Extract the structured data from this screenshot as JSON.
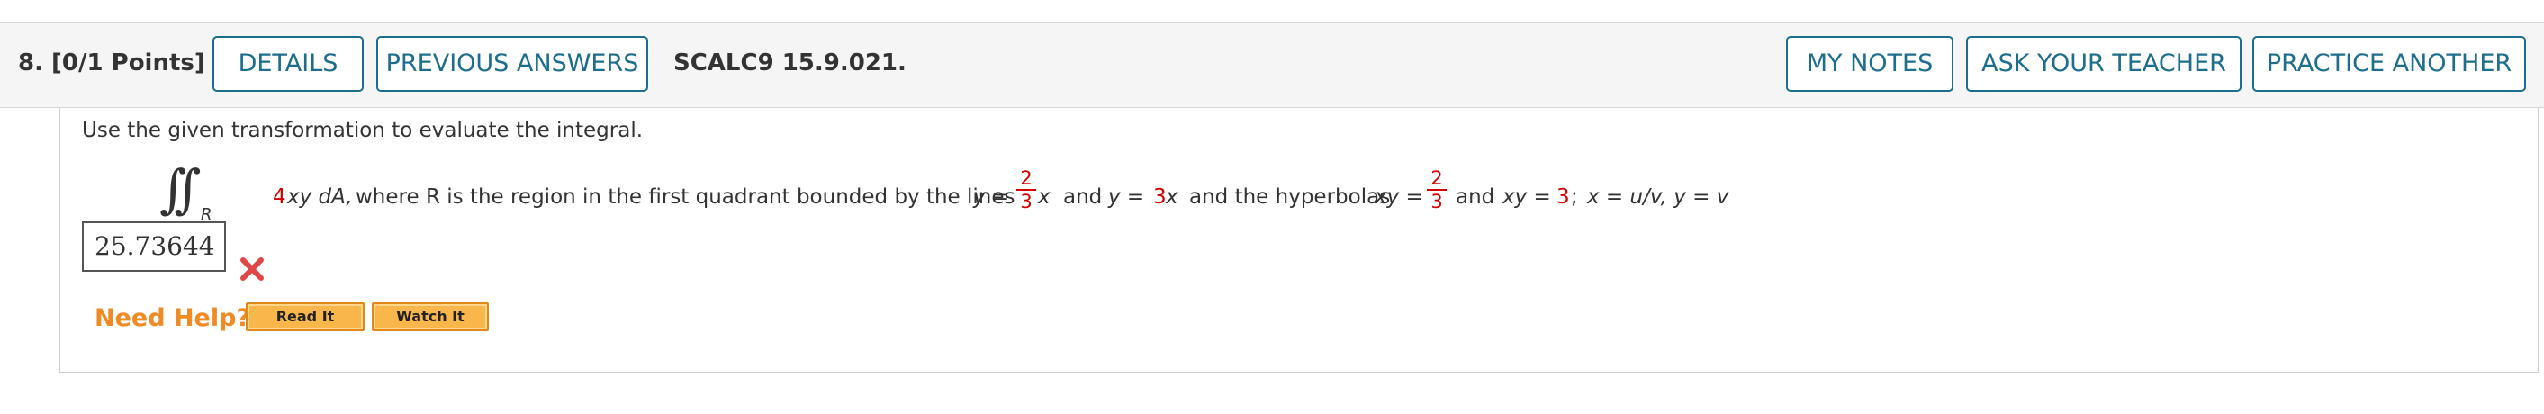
{
  "header": {
    "question_label": "8.  [0/1 Points]",
    "details_label": "DETAILS",
    "previous_answers_label": "PREVIOUS ANSWERS",
    "question_id": "SCALC9 15.9.021.",
    "my_notes_label": "MY NOTES",
    "ask_teacher_label": "ASK YOUR TEACHER",
    "practice_another_label": "PRACTICE ANOTHER"
  },
  "question": {
    "prompt": "Use the given transformation to evaluate the integral.",
    "integral_region": "R",
    "integrand_coef": "4",
    "integrand_rest": "xy dA,",
    "text_where": "where R is the region in the first quadrant bounded by the lines",
    "line1_lhs": "y =",
    "line1_frac_num": "2",
    "line1_frac_den": "3",
    "line1_var": "x",
    "and1": "and",
    "line2_lhs": "y =",
    "line2_coef": "3",
    "line2_var": "x",
    "text_hyperbolas": "and the hyperbolas",
    "hyp1_lhs": "xy =",
    "hyp1_frac_num": "2",
    "hyp1_frac_den": "3",
    "and2": "and",
    "hyp2_lhs": "xy =",
    "hyp2_val": "3",
    "semicolon": ";",
    "transformation": "x = u/v, y = v"
  },
  "answer": {
    "value": "25.73644",
    "status": "incorrect"
  },
  "help": {
    "need_help_label": "Need Help?",
    "read_it_label": "Read It",
    "watch_it_label": "Watch It"
  },
  "colors": {
    "link_blue": "#1c6e8c",
    "error_red": "#e04646",
    "help_orange": "#f08a24",
    "button_orange": "#f9b64b"
  }
}
